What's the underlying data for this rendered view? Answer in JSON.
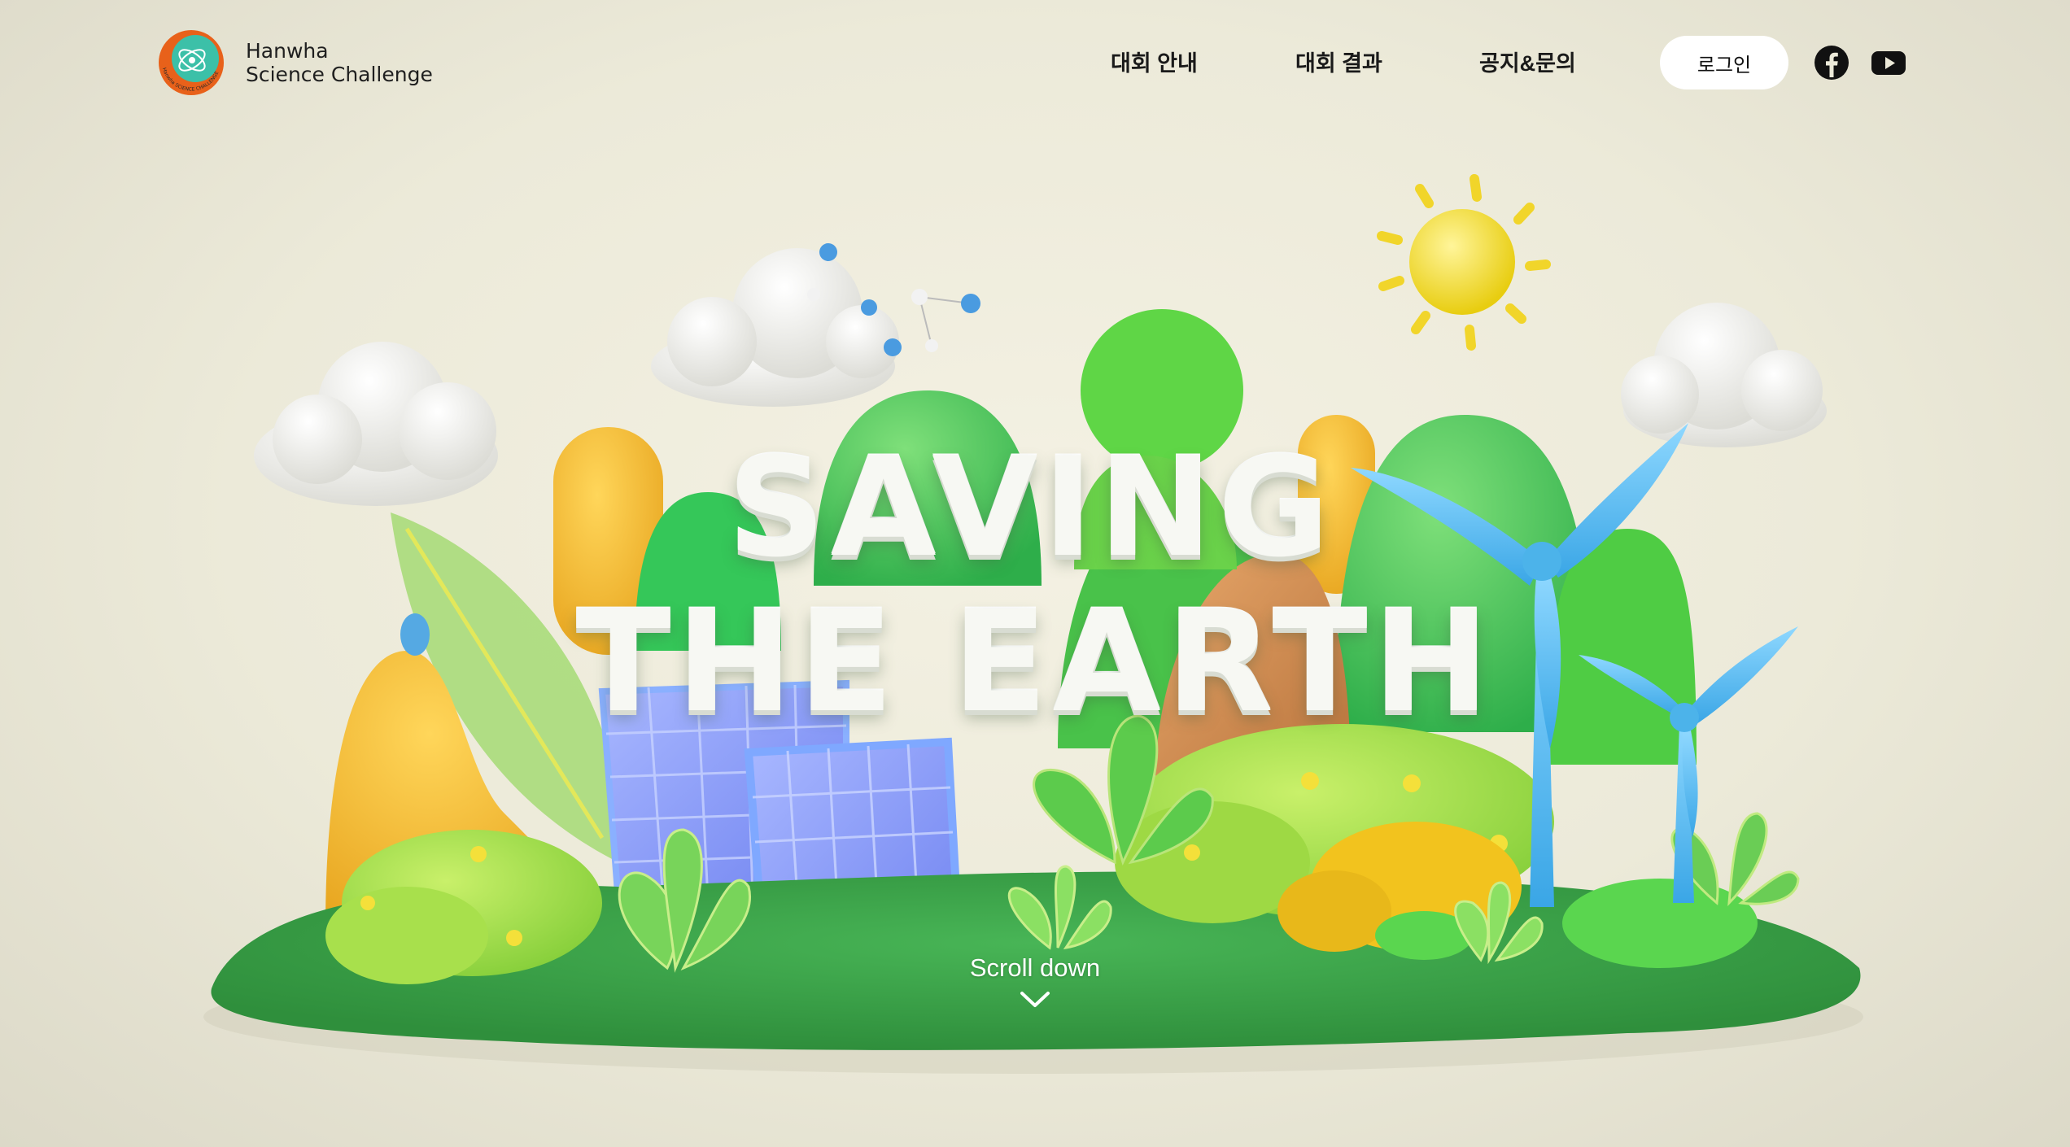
{
  "brand": {
    "name_line1": "Hanwha",
    "name_line2": "Science Challenge",
    "seal_text": "Hanwha SCIENCE CHALLENGE"
  },
  "nav": {
    "items": [
      {
        "label": "대회 안내"
      },
      {
        "label": "대회 결과"
      },
      {
        "label": "공지&문의"
      }
    ],
    "login_label": "로그인",
    "social": [
      {
        "icon": "facebook-icon"
      },
      {
        "icon": "youtube-icon"
      }
    ]
  },
  "hero": {
    "title_line1": "SAVING",
    "title_line2": "THE EARTH"
  },
  "scroll": {
    "label": "Scroll down",
    "icon": "chevron-down-icon"
  },
  "colors": {
    "background": "#eceada",
    "grass": "#3fa84c",
    "accent_blue": "#4cb3ea",
    "sun": "#f2d92a"
  }
}
